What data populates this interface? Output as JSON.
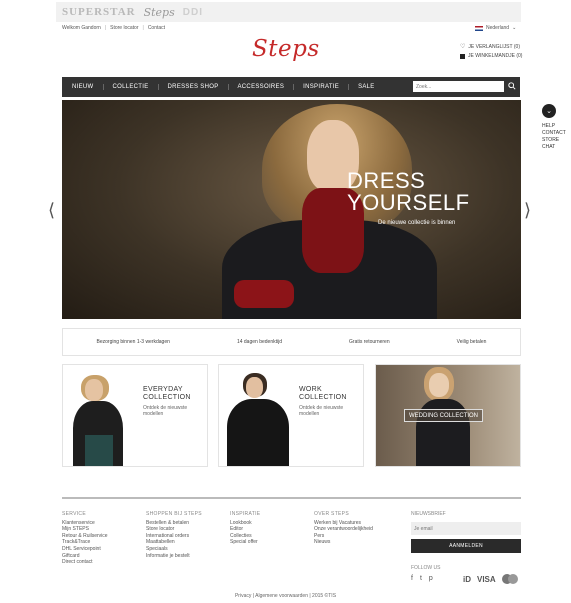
{
  "brand_bar": {
    "brand1": "SUPERSTAR",
    "brand2": "Steps",
    "brand3": "DDI"
  },
  "top_links": [
    "Welkom Gandorn",
    "Store locator",
    "Contact"
  ],
  "language": {
    "label": "Nederland"
  },
  "logo": "Steps",
  "utility": {
    "wishlist": "JE VERLANGLIJST (0)",
    "cart": "JE WINKELMANDJE (0)"
  },
  "nav": {
    "items": [
      "NIEUW",
      "COLLECTIE",
      "DRESSES SHOP",
      "ACCESSOIRES",
      "INSPIRATIE",
      "SALE"
    ],
    "search_placeholder": "Zoek..."
  },
  "side_links": [
    "HELP",
    "CONTACT",
    "STORE",
    "CHAT"
  ],
  "hero": {
    "title_line1": "DRESS",
    "title_line2": "YOURSELF",
    "subtitle": "De nieuwe collectie is binnen"
  },
  "usp": [
    "Bezorging binnen 1-3 werkdagen",
    "14 dagen bedenktijd",
    "Gratis retourneren",
    "Veilig betalen"
  ],
  "cards": [
    {
      "title_line1": "EVERYDAY",
      "title_line2": "COLLECTION",
      "desc_line1": "Ontdek de nieuwste",
      "desc_line2": "modellen"
    },
    {
      "title_line1": "WORK",
      "title_line2": "COLLECTION",
      "desc_line1": "Ontdek de nieuwste",
      "desc_line2": "modellen"
    },
    {
      "label": "WEDDING COLLECTION"
    }
  ],
  "footer": {
    "columns": [
      {
        "heading": "SERVICE",
        "links": [
          "Klantenservice",
          "Mijn STEPS",
          "Retour & Ruilservice",
          "Track&Trace",
          "DHL Servicepoint",
          "Giftcard",
          "Direct contact"
        ]
      },
      {
        "heading": "SHOPPEN BIJ STEPS",
        "links": [
          "Bestellen & betalen",
          "Store locator",
          "International orders",
          "Maattabellen",
          "Speciaals",
          "Informatie je bestelt"
        ]
      },
      {
        "heading": "INSPIRATIE",
        "links": [
          "Lookbook",
          "Editor",
          "Collecties",
          "Special offer"
        ]
      },
      {
        "heading": "OVER STEPS",
        "links": [
          "Werken bij Vacatures",
          "Onze verantwoordelijkheid",
          "Pers",
          "Nieuws"
        ]
      }
    ],
    "newsletter": {
      "heading": "NIEUWSBRIEF",
      "placeholder": "Je email",
      "button": "AANMELDEN"
    },
    "follow_heading": "FOLLOW US",
    "social": [
      "f",
      "t",
      "p"
    ],
    "payments": {
      "ideal": "iD",
      "visa": "VISA"
    },
    "bottom": "Privacy  |  Algemene voorwaarden  |  2015 ©TIS"
  },
  "colors": {
    "logo": "#c52a2a",
    "nav": "#333333",
    "button": "#2a2a2a"
  }
}
